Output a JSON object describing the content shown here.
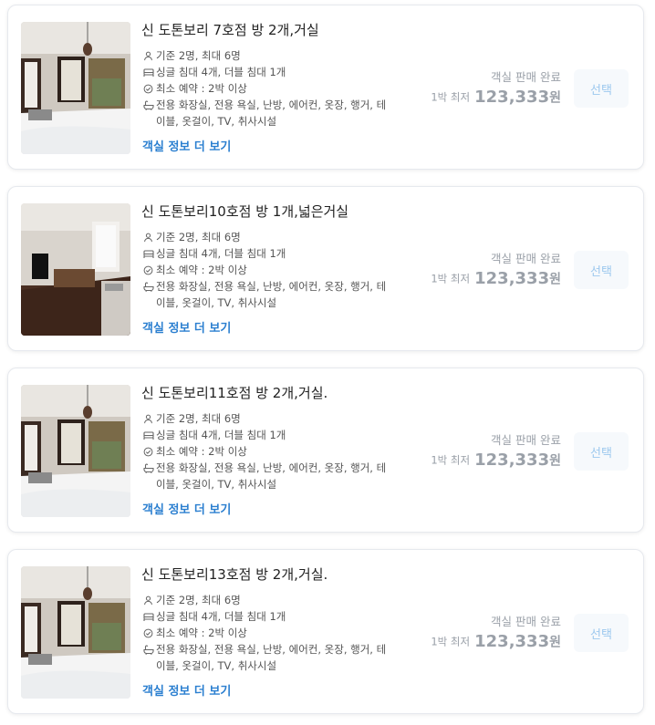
{
  "rooms": [
    {
      "title": "신 도톤보리 7호점 방 2개,거실",
      "specs": [
        "기준 2명, 최대 6명",
        "싱글 침대 4개, 더블 침대 1개",
        "최소 예약 : 2박 이상",
        "전용 화장실, 전용 욕실, 난방, 에어컨, 옷장, 행거, 테이블, 옷걸이, TV, 취사시설"
      ],
      "more_label": "객실 정보 더 보기",
      "sold_out": "객실 판매 완료",
      "price_label": "1박 최저",
      "price": "123,333",
      "currency": "원",
      "select_label": "선택"
    },
    {
      "title": "신 도톤보리10호점 방 1개,넓은거실",
      "specs": [
        "기준 2명, 최대 6명",
        "싱글 침대 4개, 더블 침대 1개",
        "최소 예약 : 2박 이상",
        "전용 화장실, 전용 욕실, 난방, 에어컨, 옷장, 행거, 테이블, 옷걸이, TV, 취사시설"
      ],
      "more_label": "객실 정보 더 보기",
      "sold_out": "객실 판매 완료",
      "price_label": "1박 최저",
      "price": "123,333",
      "currency": "원",
      "select_label": "선택"
    },
    {
      "title": "신 도톤보리11호점 방 2개,거실.",
      "specs": [
        "기준 2명, 최대 6명",
        "싱글 침대 4개, 더블 침대 1개",
        "최소 예약 : 2박 이상",
        "전용 화장실, 전용 욕실, 난방, 에어컨, 옷장, 행거, 테이블, 옷걸이, TV, 취사시설"
      ],
      "more_label": "객실 정보 더 보기",
      "sold_out": "객실 판매 완료",
      "price_label": "1박 최저",
      "price": "123,333",
      "currency": "원",
      "select_label": "선택"
    },
    {
      "title": "신 도톤보리13호점 방 2개,거실.",
      "specs": [
        "기준 2명, 최대 6명",
        "싱글 침대 4개, 더블 침대 1개",
        "최소 예약 : 2박 이상",
        "전용 화장실, 전용 욕실, 난방, 에어컨, 옷장, 행거, 테이블, 옷걸이, TV, 취사시설"
      ],
      "more_label": "객실 정보 더 보기",
      "sold_out": "객실 판매 완료",
      "price_label": "1박 최저",
      "price": "123,333",
      "currency": "원",
      "select_label": "선택"
    }
  ],
  "colors": {
    "link": "#2b7fd0",
    "muted": "#9aa0a8",
    "select_text": "#9cc8ee"
  },
  "icons": [
    "person-icon",
    "bed-icon",
    "check-circle-icon",
    "bathtub-icon"
  ]
}
